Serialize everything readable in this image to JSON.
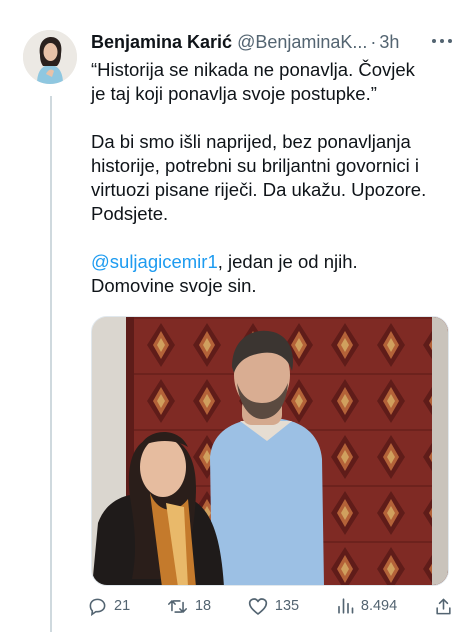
{
  "tweet": {
    "author_name": "Benjamina Karić",
    "author_handle": "@BenjaminaK...",
    "separator": "·",
    "time": "3h",
    "lines": [
      "“Historija se nikada ne ponavlja. Čovjek",
      "je taj koji ponavlja svoje postupke.”",
      "Da bi smo išli naprijed, bez ponavljanja",
      "historije, potrebni su briljantni govornici i",
      "virtuozi pisane riječi. Da ukažu. Upozore.",
      "Podsjete."
    ],
    "mention": "@suljagicemir1",
    "mention_rest": ", jedan je od njih.",
    "last_line": "Domovine svoje sin."
  },
  "actions": {
    "replies": "21",
    "retweets": "18",
    "likes": "135",
    "views": "8.494"
  },
  "icons": [
    "more-icon",
    "reply-icon",
    "retweet-icon",
    "like-icon",
    "views-icon",
    "share-icon"
  ],
  "colors": {
    "link": "#1d9bf0",
    "text": "#0f1419",
    "secondary": "#536471",
    "thread_line": "#cfd9de"
  }
}
